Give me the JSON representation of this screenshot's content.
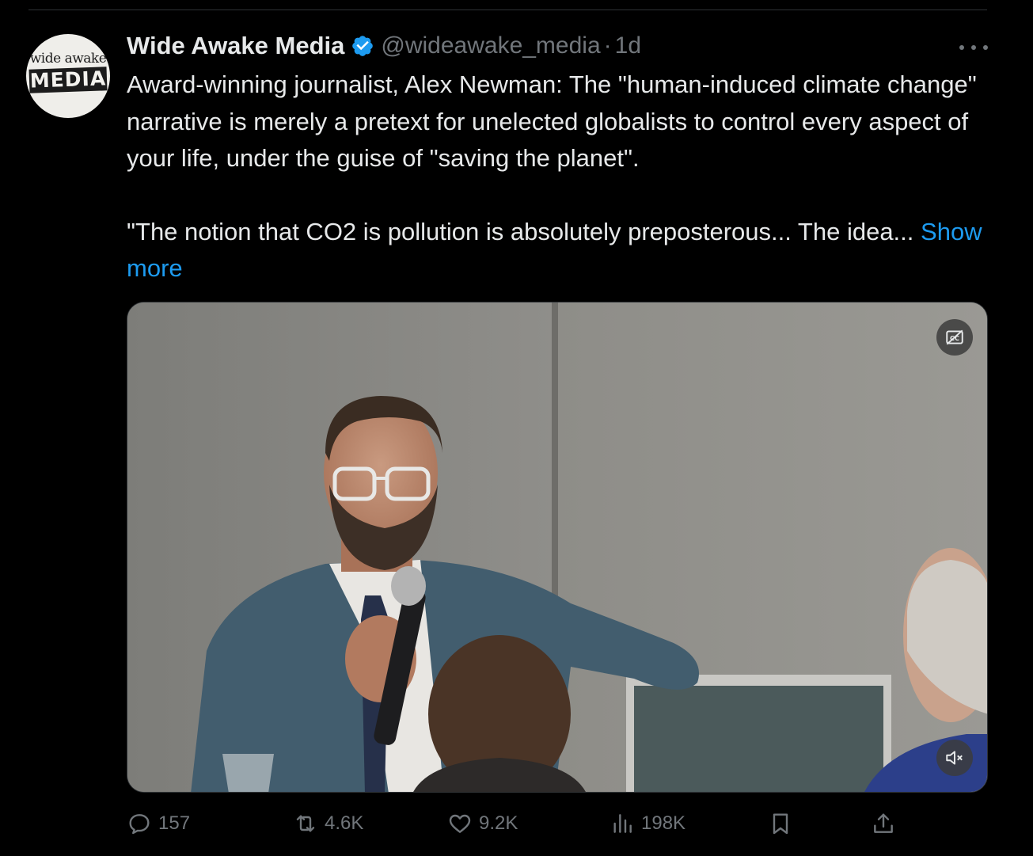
{
  "tweet": {
    "author": {
      "name": "Wide Awake Media",
      "handle": "@wideawake_media",
      "avatar_logo_top": "wide awake",
      "avatar_logo_bottom": "MEDIA",
      "verified": true,
      "verified_color": "#1d9bf0"
    },
    "separator": "·",
    "time": "1d",
    "text_paragraph_1": "Award-winning journalist, Alex Newman: The \"human-induced climate change\" narrative is merely a pretext for unelected globalists to control every aspect of your life, under the guise of \"saving the planet\".",
    "text_paragraph_2": "\"The notion that CO2 is pollution is absolutely preposterous... The idea...",
    "show_more": "Show more",
    "media": {
      "type": "video",
      "captions_icon": "closed-captions-off-icon",
      "mute_icon": "speaker-muted-icon"
    },
    "actions": {
      "replies": "157",
      "reposts": "4.6K",
      "likes": "9.2K",
      "views": "198K",
      "bookmark_icon": "bookmark-icon",
      "share_icon": "share-icon"
    }
  },
  "colors": {
    "background": "#000000",
    "text": "#e7e9ea",
    "muted": "#71767b",
    "accent": "#1d9bf0"
  }
}
